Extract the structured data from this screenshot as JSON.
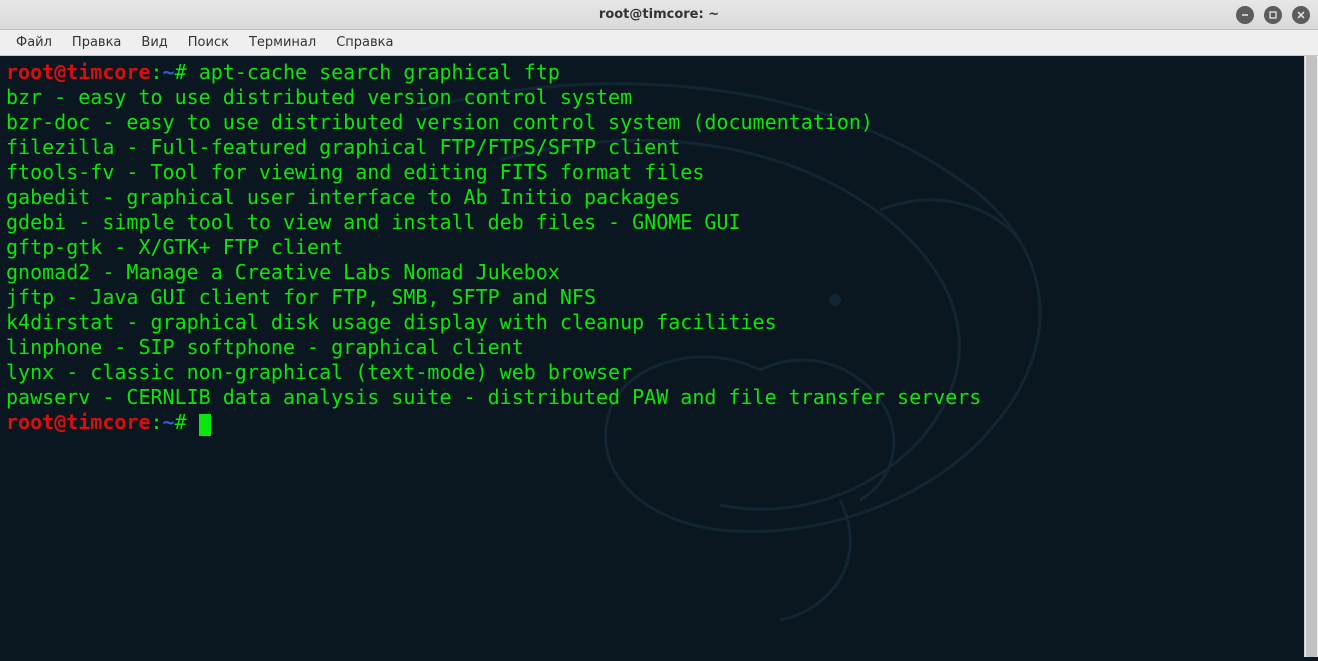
{
  "window": {
    "title": "root@timcore: ~"
  },
  "menubar": {
    "items": [
      "Файл",
      "Правка",
      "Вид",
      "Поиск",
      "Терминал",
      "Справка"
    ]
  },
  "prompt": {
    "user_host": "root@timcore",
    "separator": ":",
    "path": "~",
    "hash": "#"
  },
  "command": "apt-cache search graphical ftp",
  "output": [
    "bzr - easy to use distributed version control system",
    "bzr-doc - easy to use distributed version control system (documentation)",
    "filezilla - Full-featured graphical FTP/FTPS/SFTP client",
    "ftools-fv - Tool for viewing and editing FITS format files",
    "gabedit - graphical user interface to Ab Initio packages",
    "gdebi - simple tool to view and install deb files - GNOME GUI",
    "gftp-gtk - X/GTK+ FTP client",
    "gnomad2 - Manage a Creative Labs Nomad Jukebox",
    "jftp - Java GUI client for FTP, SMB, SFTP and NFS",
    "k4dirstat - graphical disk usage display with cleanup facilities",
    "linphone - SIP softphone - graphical client",
    "lynx - classic non-graphical (text-mode) web browser",
    "pawserv - CERNLIB data analysis suite - distributed PAW and file transfer servers"
  ]
}
